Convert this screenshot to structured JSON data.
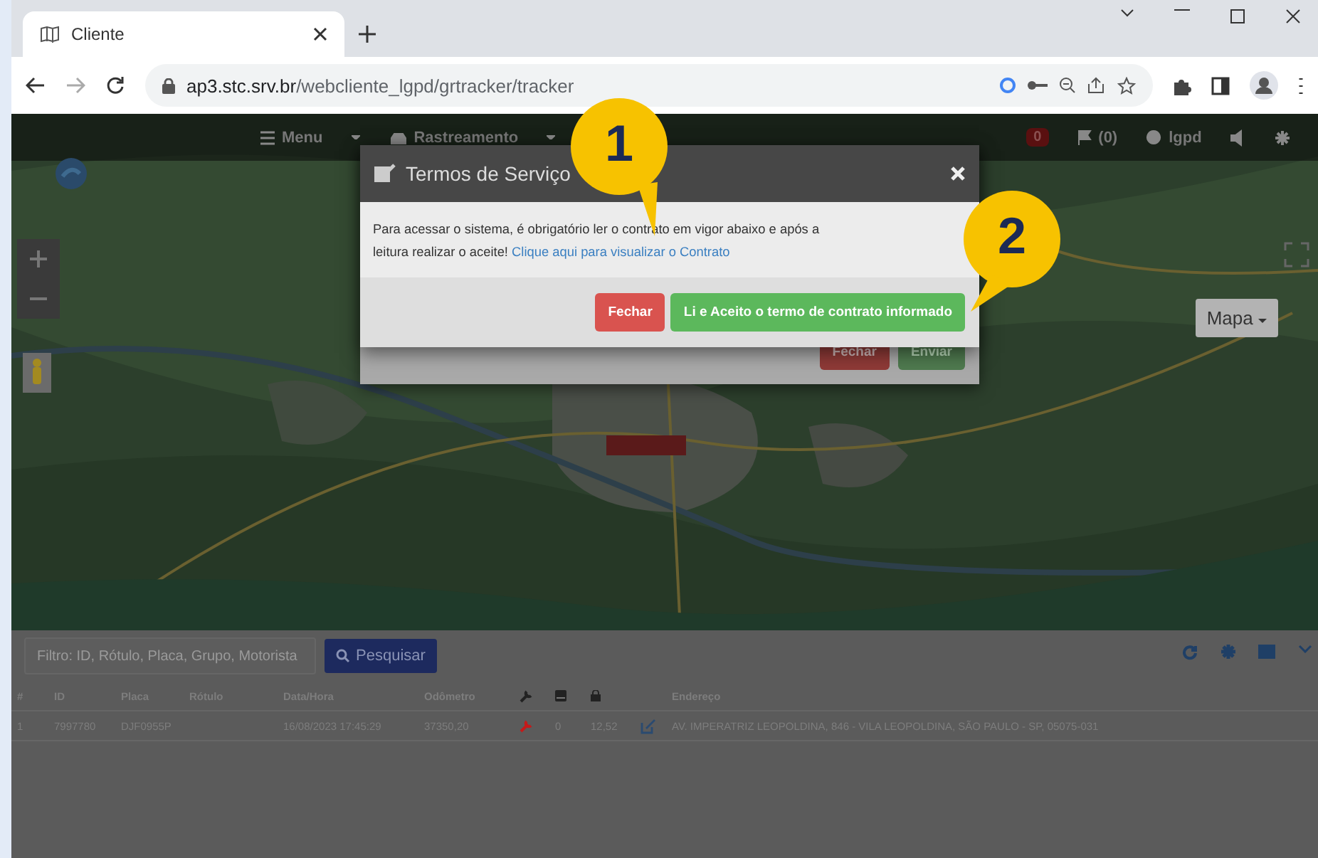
{
  "browser": {
    "tab_title": "Cliente",
    "url_host": "ap3.stc.srv.br",
    "url_path": "/webcliente_lgpd/grtracker/tracker"
  },
  "app_header": {
    "menu": "Menu",
    "tracking": "Rastreamento",
    "alert_count": "0",
    "flag_count": "(0)",
    "user": "lgpd"
  },
  "map": {
    "kind": "picture",
    "type_button": "Mapa"
  },
  "background_modal": {
    "buttons": [
      {
        "label": "Fechar",
        "kind": "danger"
      },
      {
        "label": "Enviar",
        "kind": "success"
      }
    ]
  },
  "modal": {
    "title": "Termos de Serviço",
    "body": "Para acessar o sistema, é obrigatório ler o contrato em vigor abaixo e após a leitura realizar o aceite!",
    "link": "Clique aqui para visualizar o Contrato",
    "buttons": [
      {
        "label": "Fechar",
        "kind": "danger"
      },
      {
        "label": "Li e Aceito o termo de contrato informado",
        "kind": "success"
      }
    ]
  },
  "callouts": [
    "1",
    "2"
  ],
  "filter": {
    "placeholder": "Filtro: ID, Rótulo, Placa, Grupo, Motorista",
    "button": "Pesquisar"
  },
  "table": {
    "columns": [
      {
        "kind": "text",
        "label": "#"
      },
      {
        "kind": "text",
        "label": "ID"
      },
      {
        "kind": "text",
        "label": "Placa"
      },
      {
        "kind": "text",
        "label": "Rótulo"
      },
      {
        "kind": "text",
        "label": "Data/Hora"
      },
      {
        "kind": "text",
        "label": "Odômetro"
      },
      {
        "kind": "wrench"
      },
      {
        "kind": "drive"
      },
      {
        "kind": "lock"
      },
      {
        "kind": "blank"
      },
      {
        "kind": "text",
        "label": "Endereço"
      }
    ],
    "rows": [
      {
        "index": "1",
        "id": "7997780",
        "plate": "DJF0955P",
        "datetime": "16/08/2023 17:45:29",
        "odometer": "37350,20",
        "column_8": "0",
        "column_9": "12,52",
        "address": "AV. IMPERATRIZ LEOPOLDINA, 846 - VILA LEOPOLDINA, SÃO PAULO - SP, 05075-031"
      }
    ]
  }
}
